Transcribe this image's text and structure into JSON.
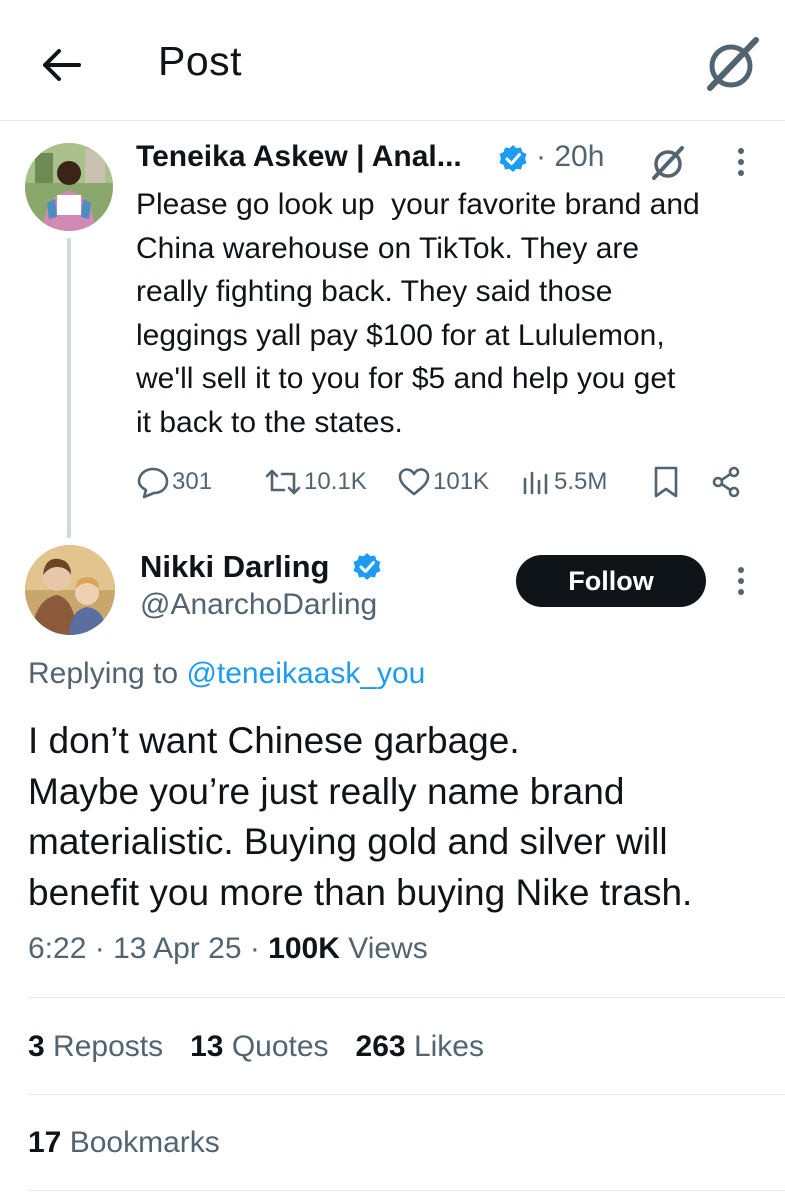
{
  "header": {
    "title": "Post",
    "back_icon": "arrow-left-icon",
    "grok_icon": "grok-icon"
  },
  "parent_tweet": {
    "author_name": "Teneika Askew | Anal...",
    "verified": true,
    "time": "· 20h",
    "text": "Please go look up  your favorite brand and\nChina warehouse on TikTok. They are\nreally fighting back. They said those\nleggings yall pay $100 for at Lululemon,\nwe'll sell it to you for $5 and help you get\nit back to the states.",
    "replies": "301",
    "reposts": "10.1K",
    "likes": "101K",
    "views": "5.5M"
  },
  "main_tweet": {
    "author_name": "Nikki Darling",
    "verified": true,
    "handle": "@AnarchoDarling",
    "follow_label": "Follow",
    "replying_prefix": "Replying to ",
    "replying_handle": "@teneikaask_you",
    "text": "I don’t want Chinese garbage.\nMaybe you’re just really name brand\nmaterialistic. Buying gold and silver will\nbenefit you more than buying Nike trash.",
    "time": "6:22",
    "date": "13 Apr 25",
    "views_count": "100K",
    "views_label": "Views",
    "reposts_count": "3",
    "reposts_label": "Reposts",
    "quotes_count": "13",
    "quotes_label": "Quotes",
    "likes_count": "263",
    "likes_label": "Likes",
    "bookmarks_count": "17",
    "bookmarks_label": "Bookmarks"
  },
  "colors": {
    "text": "#0f1419",
    "secondary": "#536471",
    "accent": "#1d9bf0",
    "divider": "#e7e9ea",
    "follow_bg": "#0f1419"
  }
}
